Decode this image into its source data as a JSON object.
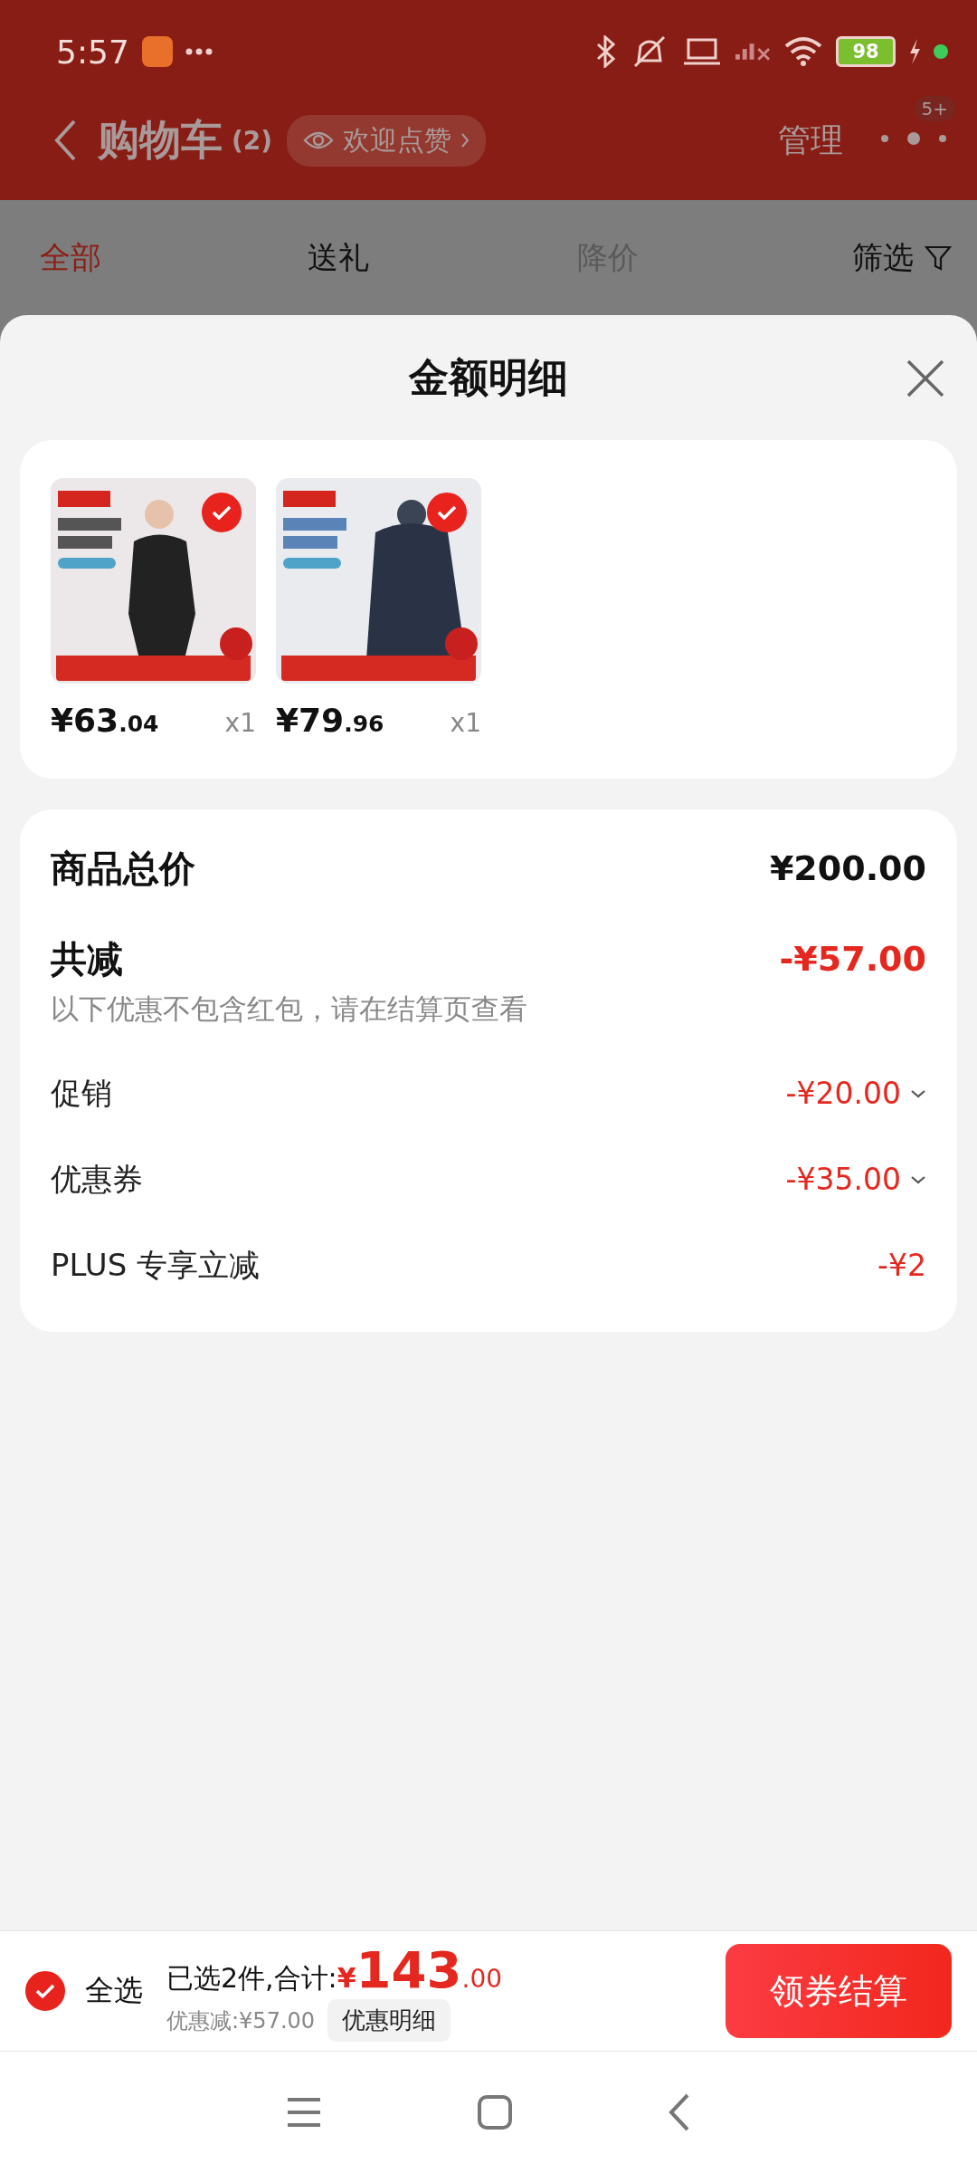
{
  "status_bar": {
    "time": "5:57",
    "battery": "98"
  },
  "header": {
    "title": "购物车",
    "count": "(2)",
    "like_button": "欢迎点赞",
    "manage": "管理",
    "badge": "5+"
  },
  "tabs": [
    {
      "label": "全部",
      "selected": true,
      "disabled": false
    },
    {
      "label": "送礼",
      "selected": false,
      "disabled": false
    },
    {
      "label": "降价",
      "selected": false,
      "disabled": true
    }
  ],
  "filter": "筛选",
  "sheet": {
    "title": "金额明细",
    "products": [
      {
        "price_main": "¥63",
        "price_decimal": ".04",
        "quantity": "x1",
        "selected": true,
        "kind": "picture"
      },
      {
        "price_main": "¥79",
        "price_decimal": ".96",
        "quantity": "x1",
        "selected": true,
        "kind": "picture"
      }
    ],
    "total": {
      "label": "商品总价",
      "value": "¥200.00"
    },
    "discount": {
      "label": "共减",
      "value": "-¥57.00",
      "note": "以下优惠不包含红包，请在结算页查看"
    },
    "discount_items": [
      {
        "label": "促销",
        "value": "-¥20.00",
        "expandable": true
      },
      {
        "label": "优惠券",
        "value": "-¥35.00",
        "expandable": true
      },
      {
        "label": "PLUS 专享立减",
        "value": "-¥2",
        "expandable": false
      }
    ]
  },
  "bottom_bar": {
    "select_all": {
      "label": "全选",
      "checked": true
    },
    "selected_text": "已选2件,合计:",
    "currency": "¥",
    "total_main": "143",
    "total_decimal": ".00",
    "saving": "优惠减:¥57.00",
    "detail_button": "优惠明细",
    "checkout_button": "领券结算"
  }
}
